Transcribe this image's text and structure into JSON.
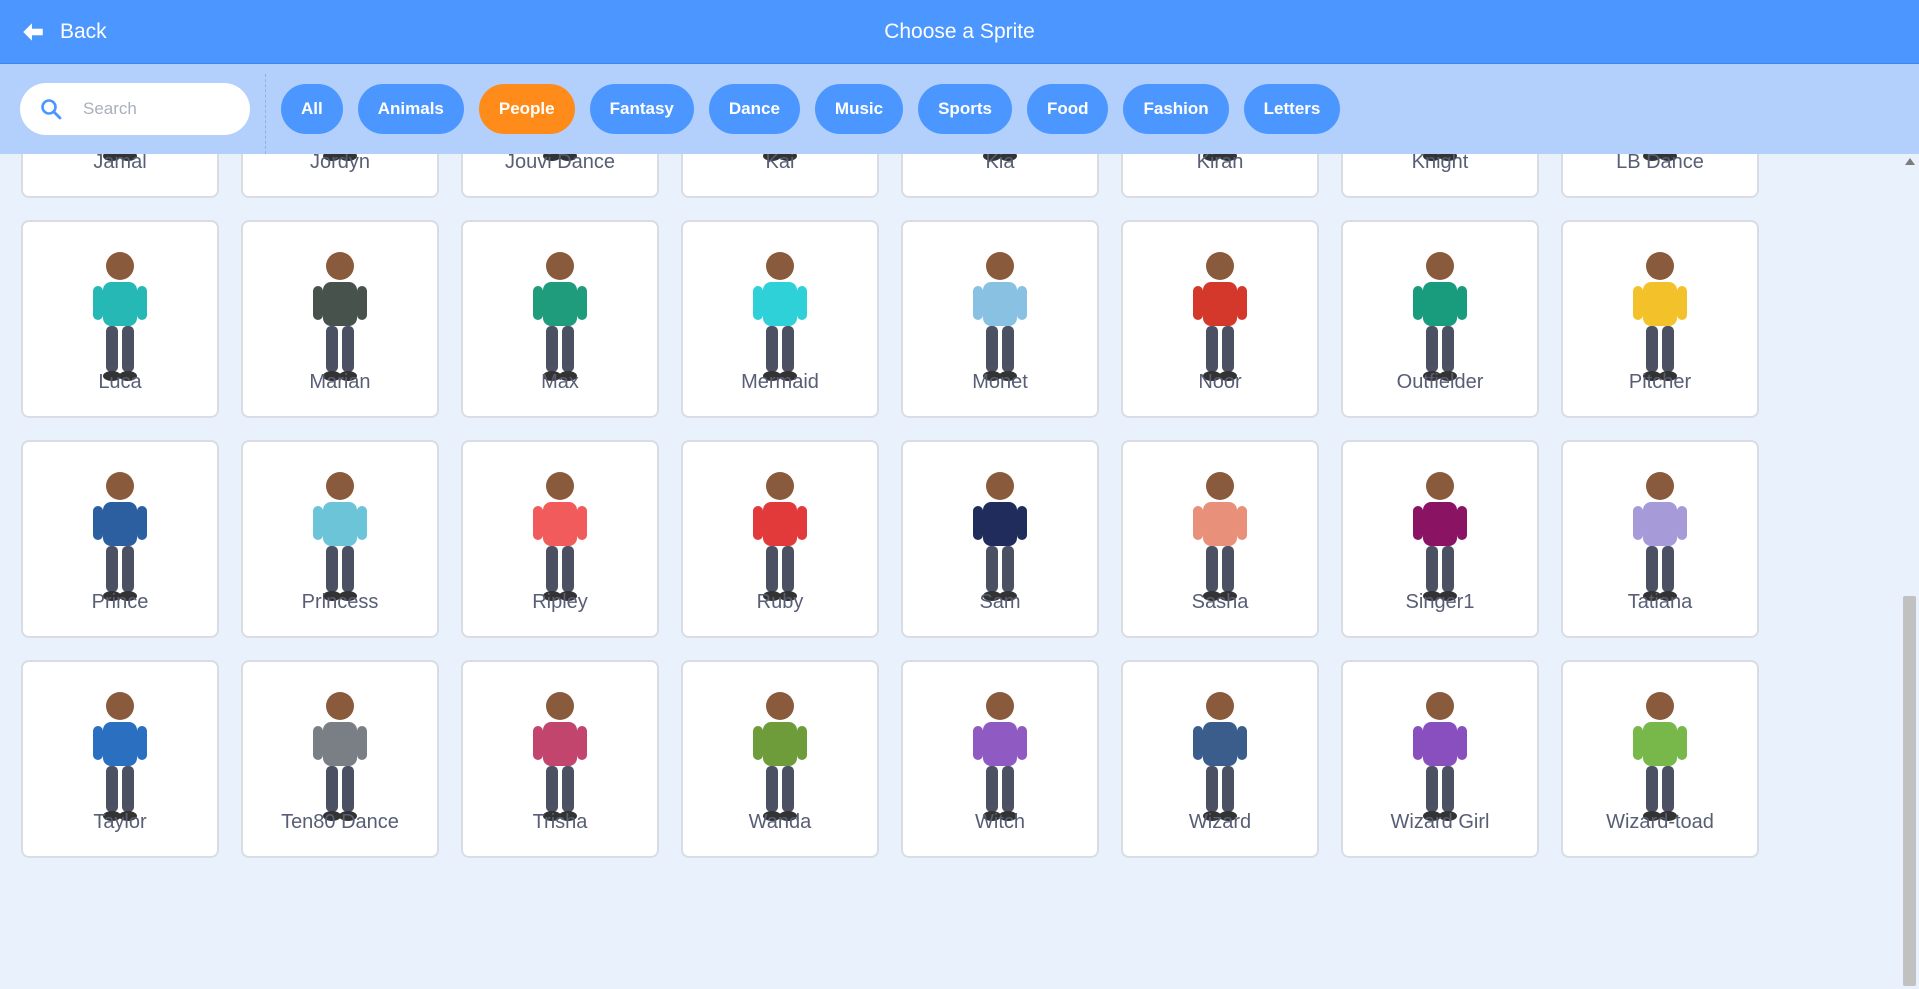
{
  "header": {
    "back_label": "Back",
    "title": "Choose a Sprite"
  },
  "search": {
    "placeholder": "Search",
    "value": ""
  },
  "tags": [
    "All",
    "Animals",
    "People",
    "Fantasy",
    "Dance",
    "Music",
    "Sports",
    "Food",
    "Fashion",
    "Letters"
  ],
  "active_tag": "People",
  "colors": {
    "header": "#4c97ff",
    "filterbar": "#b2d0fb",
    "active_tag": "#ff8c1a",
    "tag": "#4c97ff"
  },
  "sprites": [
    {
      "name": "Jamal",
      "color": "#9b3b8a"
    },
    {
      "name": "Jordyn",
      "color": "#1aa57d"
    },
    {
      "name": "Jouvi Dance",
      "color": "#d98a6b"
    },
    {
      "name": "Kai",
      "color": "#e3531d"
    },
    {
      "name": "Kia",
      "color": "#5a82c6"
    },
    {
      "name": "Kiran",
      "color": "#7fb2ef"
    },
    {
      "name": "Knight",
      "color": "#8aa0c9"
    },
    {
      "name": "LB Dance",
      "color": "#3c3c48"
    },
    {
      "name": "Luca",
      "color": "#25b8b4"
    },
    {
      "name": "Marian",
      "color": "#47524d"
    },
    {
      "name": "Max",
      "color": "#1f9c7b"
    },
    {
      "name": "Mermaid",
      "color": "#2ed1d8"
    },
    {
      "name": "Monet",
      "color": "#89c1e2"
    },
    {
      "name": "Noor",
      "color": "#d3382b"
    },
    {
      "name": "Outfielder",
      "color": "#189c7d"
    },
    {
      "name": "Pitcher",
      "color": "#f3c22b"
    },
    {
      "name": "Prince",
      "color": "#2b5f9f"
    },
    {
      "name": "Princess",
      "color": "#6cc4d8"
    },
    {
      "name": "Ripley",
      "color": "#f25b5b"
    },
    {
      "name": "Ruby",
      "color": "#e23a3a"
    },
    {
      "name": "Sam",
      "color": "#1f2c5c"
    },
    {
      "name": "Sasha",
      "color": "#e8907a"
    },
    {
      "name": "Singer1",
      "color": "#8a1463"
    },
    {
      "name": "Tatiana",
      "color": "#a69ad8"
    },
    {
      "name": "Taylor",
      "color": "#2a6fc0"
    },
    {
      "name": "Ten80 Dance",
      "color": "#7a7f86"
    },
    {
      "name": "Trisha",
      "color": "#c2456e"
    },
    {
      "name": "Wanda",
      "color": "#6f9c3a"
    },
    {
      "name": "Witch",
      "color": "#8f5ac2"
    },
    {
      "name": "Wizard",
      "color": "#3a5d8c"
    },
    {
      "name": "Wizard Girl",
      "color": "#8a4fbf"
    },
    {
      "name": "Wizard-toad",
      "color": "#78b84a"
    }
  ]
}
